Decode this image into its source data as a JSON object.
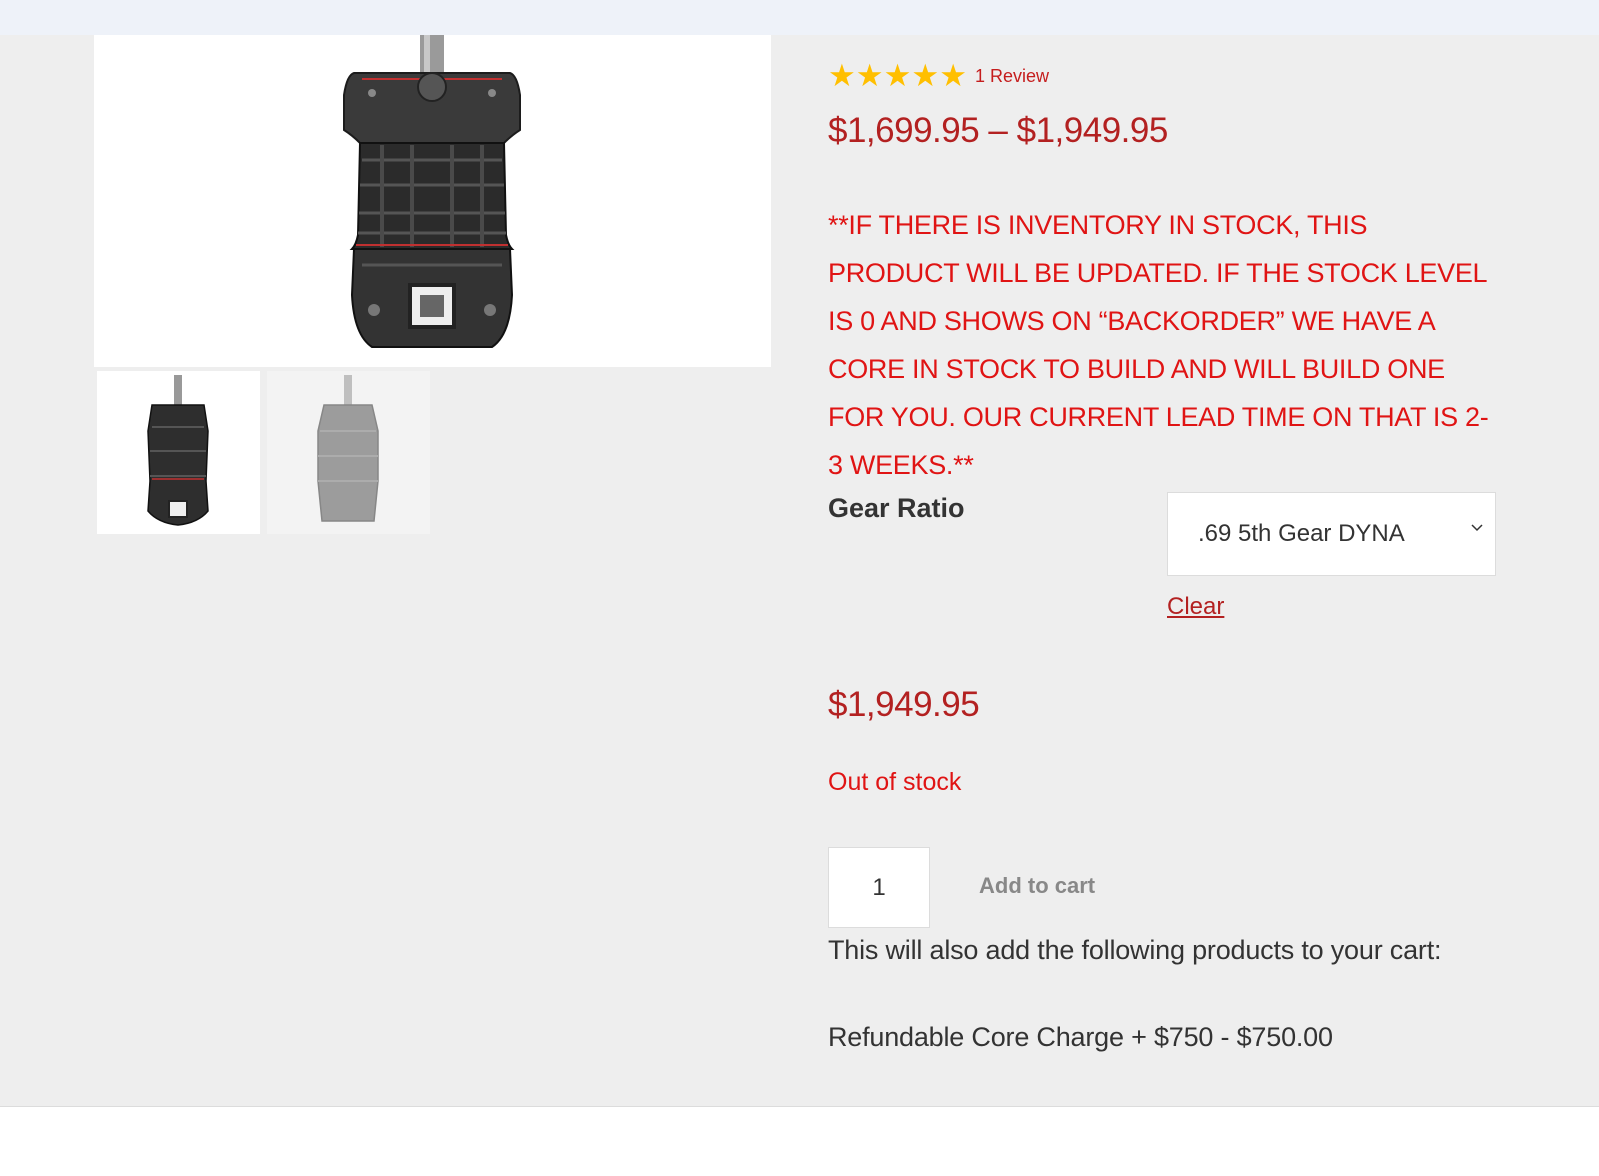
{
  "rating": {
    "stars": 5,
    "star_glyph": "★",
    "review_link": "1 Review"
  },
  "price_range": "$1,699.95 – $1,949.95",
  "notice": "**IF THERE IS INVENTORY IN STOCK, THIS PRODUCT WILL BE UPDATED.  IF THE STOCK LEVEL IS 0 AND SHOWS ON “BACKORDER” WE HAVE A CORE IN STOCK TO BUILD AND WILL BUILD ONE FOR YOU. OUR CURRENT LEAD TIME ON THAT IS 2-3 WEEKS.**",
  "variation": {
    "label": "Gear Ratio",
    "selected": ".69 5th Gear DYNA",
    "clear_label": "Clear"
  },
  "variation_price": "$1,949.95",
  "stock_status": "Out of stock",
  "cart": {
    "quantity": "1",
    "add_label": "Add to cart"
  },
  "addons": {
    "intro": "This will also add the following products to your cart:",
    "item": "Refundable Core Charge + $750 - $750.00"
  },
  "colors": {
    "price": "#b32121",
    "notice": "#e01414",
    "star": "#ffbf00"
  },
  "icons": [
    "star-icon",
    "chevron-down-icon"
  ]
}
